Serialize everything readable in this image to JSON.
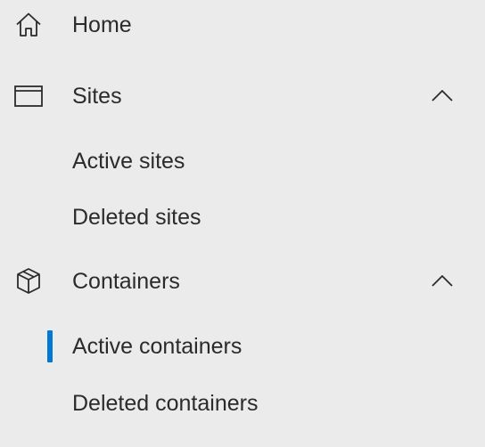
{
  "nav": {
    "home": {
      "label": "Home",
      "icon": "home-icon"
    },
    "sites": {
      "label": "Sites",
      "icon": "browser-window-icon",
      "expanded": true,
      "items": [
        {
          "label": "Active sites"
        },
        {
          "label": "Deleted sites"
        }
      ]
    },
    "containers": {
      "label": "Containers",
      "icon": "cube-icon",
      "expanded": true,
      "items": [
        {
          "label": "Active containers",
          "selected": true
        },
        {
          "label": "Deleted containers"
        }
      ]
    }
  },
  "colors": {
    "background": "#ebebeb",
    "text": "#2b2b2b",
    "accent": "#0078d4"
  }
}
